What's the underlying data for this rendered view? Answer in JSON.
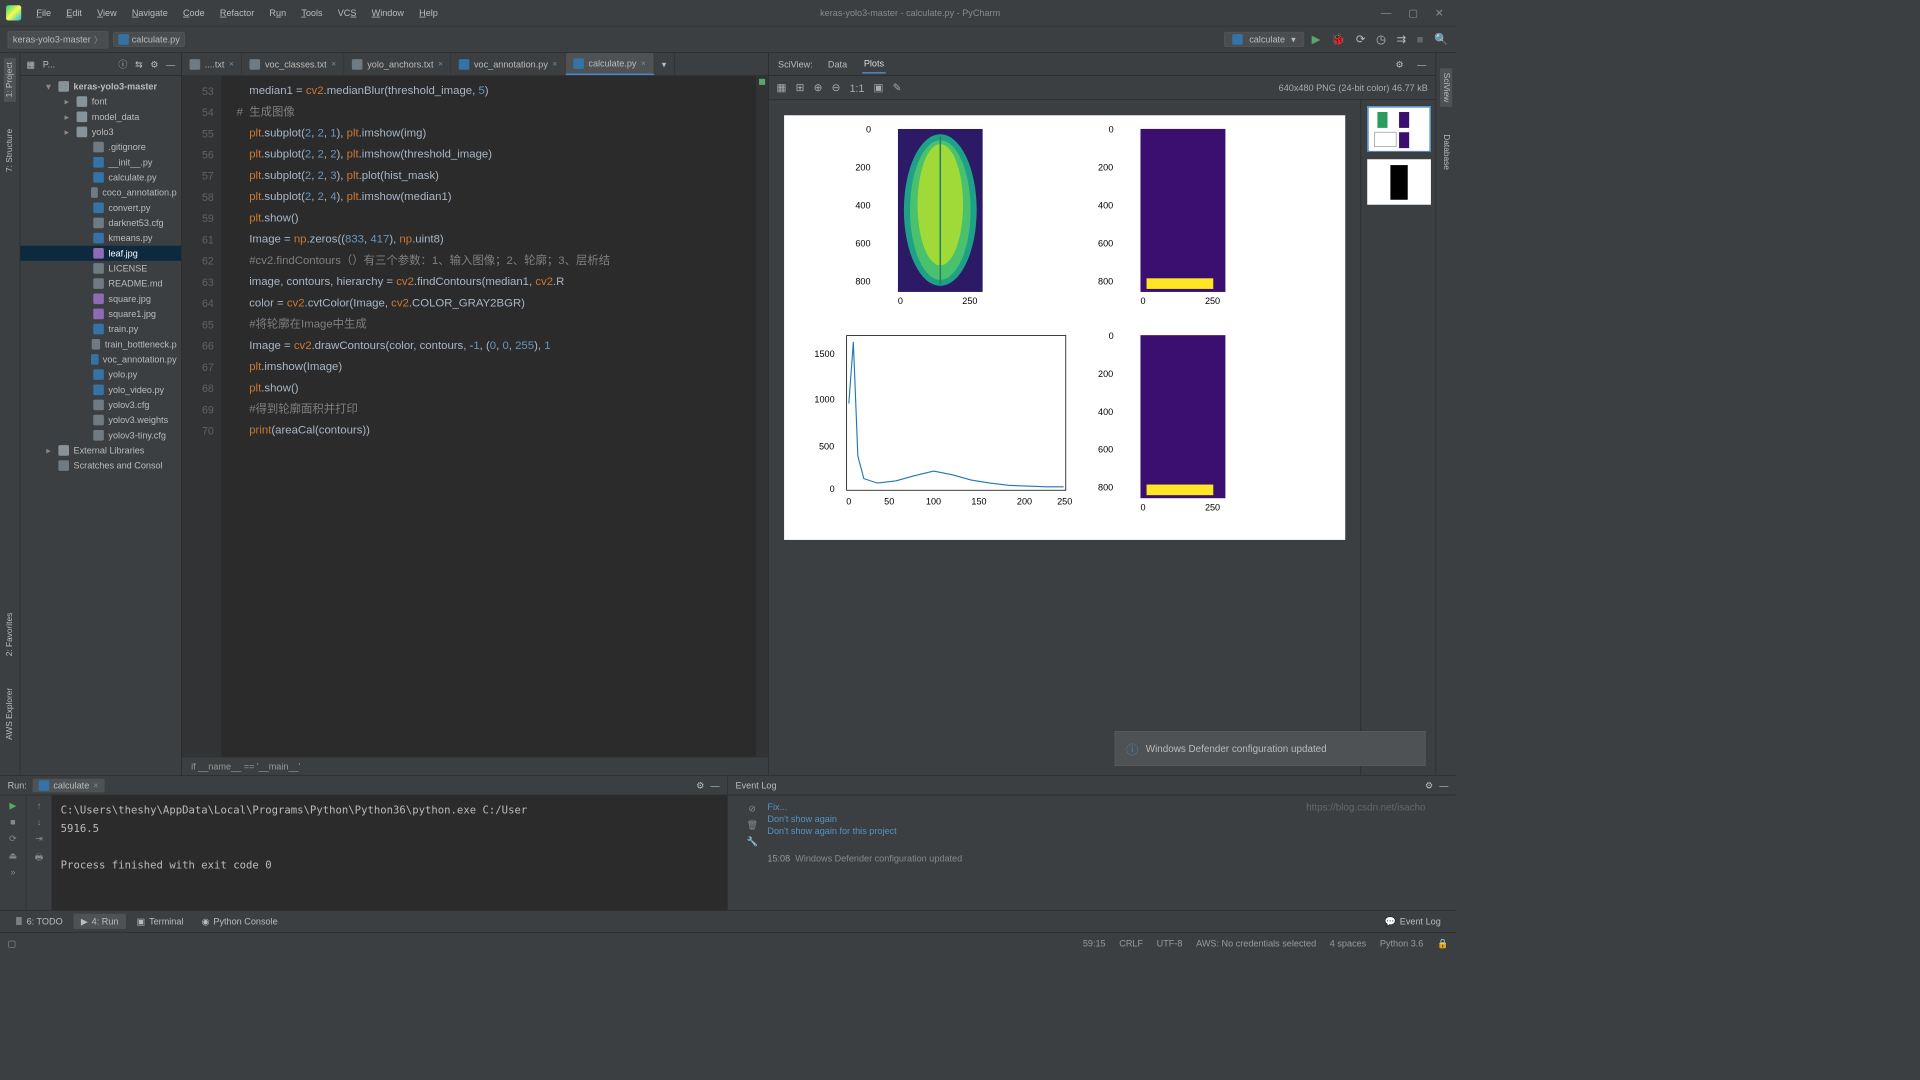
{
  "window": {
    "title": "keras-yolo3-master - calculate.py - PyCharm"
  },
  "menu": [
    "File",
    "Edit",
    "View",
    "Navigate",
    "Code",
    "Refactor",
    "Run",
    "Tools",
    "VCS",
    "Window",
    "Help"
  ],
  "breadcrumbs": {
    "root": "keras-yolo3-master",
    "file": "calculate.py"
  },
  "run_config": {
    "name": "calculate"
  },
  "project_title": "P...",
  "tree": {
    "root": "keras-yolo3-master",
    "folders": [
      "font",
      "model_data",
      "yolo3"
    ],
    "files": [
      ".gitignore",
      "__init__.py",
      "calculate.py",
      "coco_annotation.p",
      "convert.py",
      "darknet53.cfg",
      "kmeans.py",
      "leaf.jpg",
      "LICENSE",
      "README.md",
      "square.jpg",
      "square1.jpg",
      "train.py",
      "train_bottleneck.p",
      "voc_annotation.py",
      "yolo.py",
      "yolo_video.py",
      "yolov3.cfg",
      "yolov3.weights",
      "yolov3-tiny.cfg"
    ],
    "external": "External Libraries",
    "scratches": "Scratches and Consol",
    "selected": "leaf.jpg"
  },
  "editor_tabs": [
    {
      "label": "....txt"
    },
    {
      "label": "voc_classes.txt"
    },
    {
      "label": "yolo_anchors.txt"
    },
    {
      "label": "voc_annotation.py"
    },
    {
      "label": "calculate.py",
      "active": true
    }
  ],
  "gutter_lines": [
    "53",
    "",
    "54",
    "55",
    "56",
    "57",
    "58",
    "59",
    "",
    "61",
    "62",
    "63",
    "64",
    "65",
    "66",
    "67",
    "68",
    "69",
    "70"
  ],
  "code_lines": [
    {
      "raw": "    median1 = cv2.medianBlur(threshold_image, 5)"
    },
    {
      "raw": ""
    },
    {
      "raw": "#  生成图像",
      "cls": "cm"
    },
    {
      "raw": "    plt.subplot(2, 2, 1), plt.imshow(img)"
    },
    {
      "raw": "    plt.subplot(2, 2, 2), plt.imshow(threshold_image)"
    },
    {
      "raw": "    plt.subplot(2, 2, 3), plt.plot(hist_mask)"
    },
    {
      "raw": "    plt.subplot(2, 2, 4), plt.imshow(median1)"
    },
    {
      "raw": "    plt.show()"
    },
    {
      "raw": ""
    },
    {
      "raw": "    Image = np.zeros((833, 417), np.uint8)"
    },
    {
      "raw": "    #cv2.findContours（）有三个参数：1、输入图像；2、轮廓；3、层析结",
      "cls": "cm"
    },
    {
      "raw": "    image, contours, hierarchy = cv2.findContours(median1, cv2.R"
    },
    {
      "raw": "    color = cv2.cvtColor(Image, cv2.COLOR_GRAY2BGR)"
    },
    {
      "raw": "    #将轮廓在Image中生成",
      "cls": "cm"
    },
    {
      "raw": "    Image = cv2.drawContours(color, contours, -1, (0, 0, 255), 1"
    },
    {
      "raw": "    plt.imshow(Image)"
    },
    {
      "raw": "    plt.show()"
    },
    {
      "raw": "    #得到轮廓面积并打印",
      "cls": "cm"
    },
    {
      "raw": "    print(areaCal(contours))"
    }
  ],
  "breadcrumb_context": "if __name__ == '__main__'",
  "sciview": {
    "title": "SciView:",
    "tabs": [
      "Data",
      "Plots"
    ],
    "active_tab": "Plots",
    "meta": "640x480 PNG (24-bit color) 46.77 kB",
    "toolbar_11": "1:1"
  },
  "chart_data": [
    {
      "pos": "top-left",
      "type": "image",
      "yticks": [
        0,
        200,
        400,
        600,
        800
      ],
      "xticks": [
        0,
        250
      ],
      "desc": "leaf viridis image"
    },
    {
      "pos": "top-right",
      "type": "image",
      "yticks": [
        0,
        200,
        400,
        600,
        800
      ],
      "xticks": [
        0,
        250
      ],
      "desc": "threshold dark with yellow bottom band"
    },
    {
      "pos": "bottom-left",
      "type": "line",
      "x": [
        0,
        10,
        20,
        40,
        60,
        80,
        100,
        120,
        140,
        160,
        180,
        200,
        220,
        240,
        255
      ],
      "y": [
        900,
        1600,
        350,
        80,
        40,
        70,
        110,
        120,
        85,
        60,
        40,
        25,
        15,
        10,
        8
      ],
      "yticks": [
        0,
        500,
        1000,
        1500
      ],
      "xticks": [
        0,
        50,
        100,
        150,
        200,
        250
      ],
      "xlabel": "",
      "ylabel": ""
    },
    {
      "pos": "bottom-right",
      "type": "image",
      "yticks": [
        0,
        200,
        400,
        600,
        800
      ],
      "xticks": [
        0,
        250
      ],
      "desc": "median dark with yellow bottom band"
    }
  ],
  "run_panel": {
    "title": "Run:",
    "tab": "calculate",
    "output_lines": [
      "C:\\Users\\theshy\\AppData\\Local\\Programs\\Python\\Python36\\python.exe C:/User",
      "5916.5",
      "",
      "Process finished with exit code 0"
    ]
  },
  "event_log": {
    "title": "Event Log",
    "links": [
      "Fix...",
      "Don't show again",
      "Don't show again for this project"
    ],
    "time": "15:08",
    "msg": "Windows Defender configuration updated",
    "notif": "Windows Defender configuration updated"
  },
  "tool_windows": {
    "items": [
      {
        "icon": "≣",
        "label": "6: TODO"
      },
      {
        "icon": "▶",
        "label": "4: Run",
        "active": true
      },
      {
        "icon": "▣",
        "label": "Terminal"
      },
      {
        "icon": "◉",
        "label": "Python Console"
      }
    ],
    "right": "Event Log"
  },
  "left_tabs": [
    "1: Project",
    "7: Structure"
  ],
  "left_tabs2": [
    "2: Favorites",
    "AWS Explorer"
  ],
  "right_tabs": [
    "SciView",
    "Database"
  ],
  "status": {
    "caret": "59:15",
    "eol": "CRLF",
    "enc": "UTF-8",
    "aws": "AWS: No credentials selected",
    "indent": "4 spaces",
    "python": "Python 3.6"
  },
  "watermark": "https://blog.csdn.net/isacho"
}
